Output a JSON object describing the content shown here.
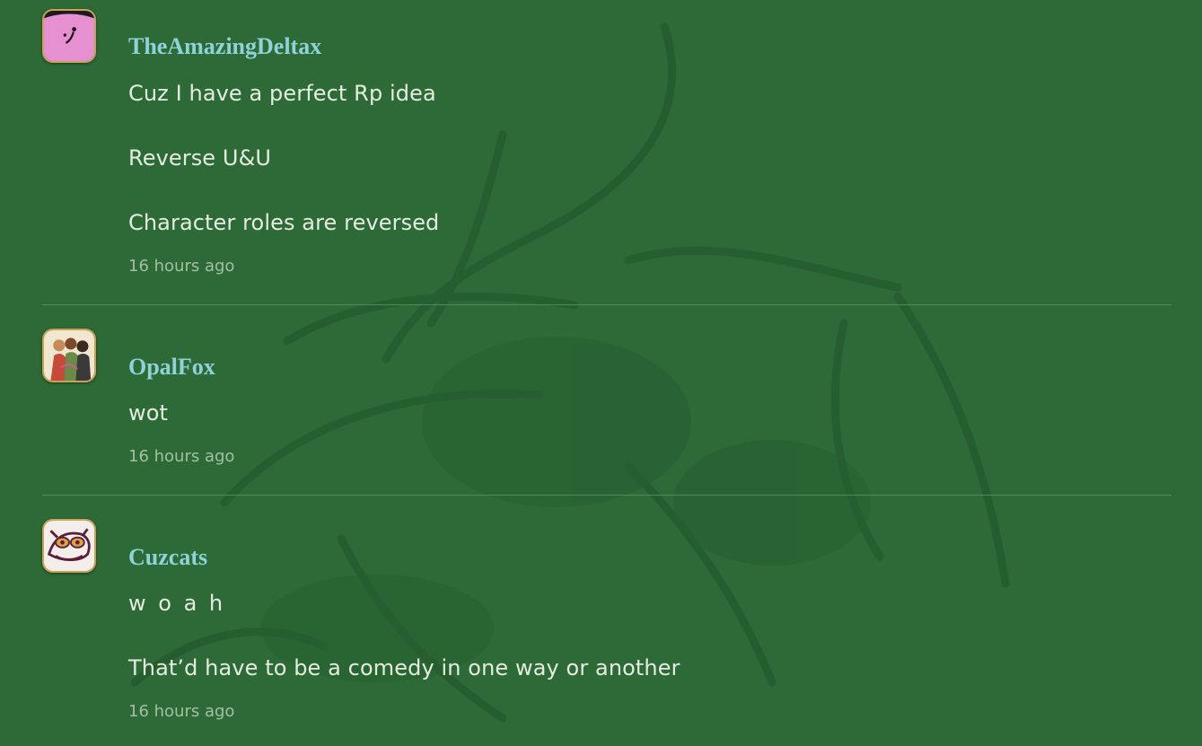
{
  "comments": [
    {
      "username": "TheAmazingDeltax",
      "avatar_icon": "pink-avatar-icon",
      "lines": [
        "Cuz I have a perfect Rp idea",
        "Reverse U&U",
        "Character roles are reversed"
      ],
      "time": "16 hours ago"
    },
    {
      "username": "OpalFox",
      "avatar_icon": "group-art-avatar-icon",
      "lines": [
        "wot"
      ],
      "time": "16 hours ago"
    },
    {
      "username": "Cuzcats",
      "avatar_icon": "cat-art-avatar-icon",
      "lines": [
        "w o a h",
        "That’d have to be a comedy in one way or another"
      ],
      "time": "16 hours ago"
    }
  ],
  "colors": {
    "background": "#2d6a37",
    "username": "#8fd3d8",
    "message": "#e4ecdf",
    "timestamp": "#a2c0a2",
    "avatar_border": "#c9a25a"
  }
}
